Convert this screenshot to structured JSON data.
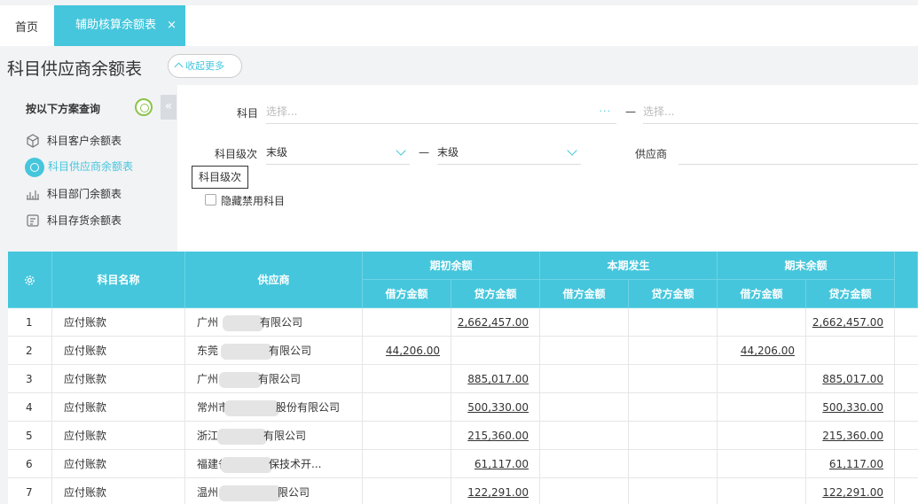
{
  "tabs": {
    "home": "首页",
    "active": "辅助核算余额表",
    "close": "×"
  },
  "page": {
    "title": "科目供应商余额表",
    "collapse_label": "收起更多"
  },
  "left_panel": {
    "title": "按以下方案查询",
    "toggle": "«",
    "items": [
      {
        "label": "科目客户余额表",
        "icon": "cube-icon"
      },
      {
        "label": "科目供应商余额表",
        "icon": "clock-icon",
        "active": true
      },
      {
        "label": "科目部门余额表",
        "icon": "chart-icon"
      },
      {
        "label": "科目存货余额表",
        "icon": "inventory-icon"
      }
    ]
  },
  "filters": {
    "subject_label": "科目",
    "subject_placeholder": "选择...",
    "subject_more": "···",
    "subject_to_placeholder": "选择...",
    "dash": "—",
    "level_label": "科目级次",
    "level_from": "末级",
    "level_to": "末级",
    "supplier_label": "供应商",
    "tooltip": "科目级次",
    "hide_disabled": "隐藏禁用科目"
  },
  "table": {
    "headers": {
      "settings_icon": "gear-icon",
      "name": "科目名称",
      "supplier": "供应商",
      "opening": "期初余额",
      "current": "本期发生",
      "closing": "期末余额",
      "debit": "借方金额",
      "credit": "贷方金额"
    },
    "rows": [
      {
        "no": "1",
        "name": "应付账款",
        "supplier": "广州",
        "supplier_tail": "有限公司",
        "op_debit": "",
        "op_credit": "2,662,457.00",
        "cur_debit": "",
        "cur_credit": "",
        "cl_debit": "",
        "cl_credit": "2,662,457.00"
      },
      {
        "no": "2",
        "name": "应付账款",
        "supplier": "东莞",
        "supplier_tail": "有限公司",
        "op_debit": "44,206.00",
        "op_credit": "",
        "cur_debit": "",
        "cur_credit": "",
        "cl_debit": "44,206.00",
        "cl_credit": ""
      },
      {
        "no": "3",
        "name": "应付账款",
        "supplier": "广州",
        "supplier_tail": "有限公司",
        "op_debit": "",
        "op_credit": "885,017.00",
        "cur_debit": "",
        "cur_credit": "",
        "cl_debit": "",
        "cl_credit": "885,017.00"
      },
      {
        "no": "4",
        "name": "应付账款",
        "supplier": "常州市",
        "supplier_tail": "股份有限公司",
        "op_debit": "",
        "op_credit": "500,330.00",
        "cur_debit": "",
        "cur_credit": "",
        "cl_debit": "",
        "cl_credit": "500,330.00"
      },
      {
        "no": "5",
        "name": "应付账款",
        "supplier": "浙江",
        "supplier_tail": "有限公司",
        "op_debit": "",
        "op_credit": "215,360.00",
        "cur_debit": "",
        "cur_credit": "",
        "cl_debit": "",
        "cl_credit": "215,360.00"
      },
      {
        "no": "6",
        "name": "应付账款",
        "supplier": "福建省",
        "supplier_tail": "保技术开...",
        "op_debit": "",
        "op_credit": "61,117.00",
        "cur_debit": "",
        "cur_credit": "",
        "cl_debit": "",
        "cl_credit": "61,117.00"
      },
      {
        "no": "7",
        "name": "应付账款",
        "supplier": "温州",
        "supplier_tail": "限公司",
        "op_debit": "",
        "op_credit": "122,291.00",
        "cur_debit": "",
        "cur_credit": "",
        "cl_debit": "",
        "cl_credit": "122,291.00"
      }
    ]
  }
}
